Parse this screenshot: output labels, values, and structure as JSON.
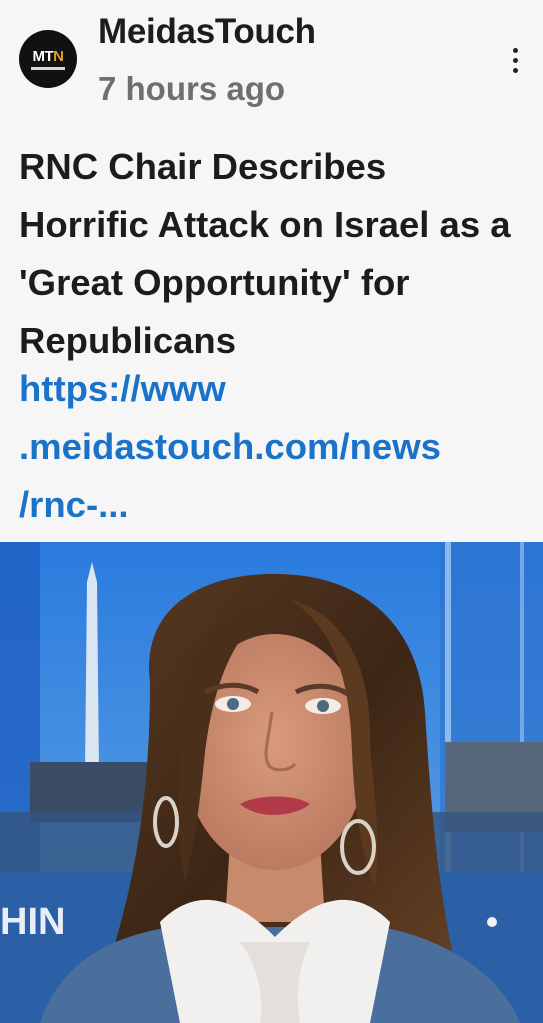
{
  "post": {
    "page_name": "MeidasTouch",
    "timestamp": "7 hours ago",
    "avatar_logo": {
      "mt": "MT",
      "n": "N"
    },
    "headline": "RNC Chair Describes Horrific Attack on Israel as a 'Great Opportunity' for Republicans",
    "link_lines": [
      "https://www",
      ".meidastouch.com/news",
      "/rnc-..."
    ],
    "image_caption_fragment": "HIN",
    "more_icon": "vertical-ellipsis-icon"
  },
  "colors": {
    "link": "#1a73c9",
    "text": "#1c1c1c",
    "meta": "#6f6f6f",
    "logo_accent": "#e0a21b"
  }
}
